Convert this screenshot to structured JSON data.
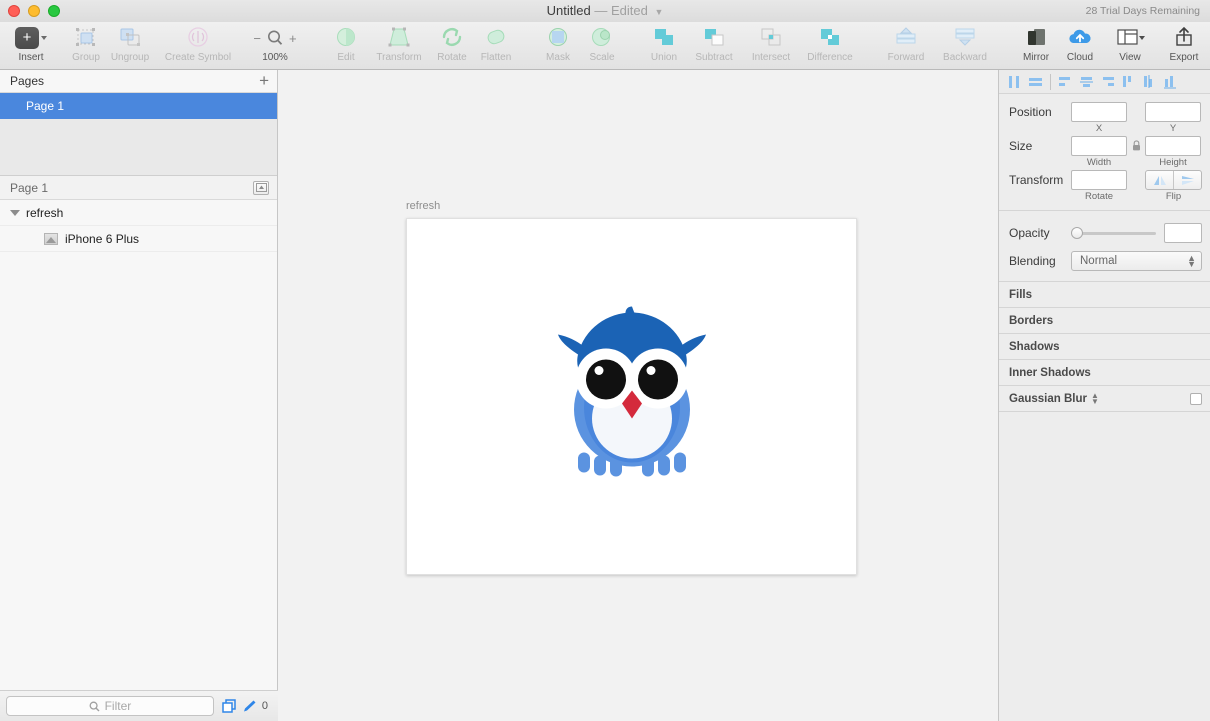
{
  "titlebar": {
    "document_name": "Untitled",
    "separator": "—",
    "edited_state": "Edited",
    "trial_notice": "28 Trial Days Remaining"
  },
  "toolbar": {
    "items": [
      {
        "label": "Insert",
        "icon": "plus-square-icon",
        "enabled": true
      },
      {
        "label": "Group",
        "icon": "group-icon",
        "enabled": false
      },
      {
        "label": "Ungroup",
        "icon": "ungroup-icon",
        "enabled": false
      },
      {
        "label": "Create Symbol",
        "icon": "create-symbol-icon",
        "enabled": false
      },
      {
        "label": "Edit",
        "icon": "edit-icon",
        "enabled": false
      },
      {
        "label": "Transform",
        "icon": "transform-icon",
        "enabled": false
      },
      {
        "label": "Rotate",
        "icon": "rotate-icon",
        "enabled": false
      },
      {
        "label": "Flatten",
        "icon": "flatten-icon",
        "enabled": false
      },
      {
        "label": "Mask",
        "icon": "mask-icon",
        "enabled": false
      },
      {
        "label": "Scale",
        "icon": "scale-icon",
        "enabled": false
      },
      {
        "label": "Union",
        "icon": "union-icon",
        "enabled": false
      },
      {
        "label": "Subtract",
        "icon": "subtract-icon",
        "enabled": false
      },
      {
        "label": "Intersect",
        "icon": "intersect-icon",
        "enabled": false
      },
      {
        "label": "Difference",
        "icon": "difference-icon",
        "enabled": false
      },
      {
        "label": "Forward",
        "icon": "move-forward-icon",
        "enabled": false
      },
      {
        "label": "Backward",
        "icon": "move-backward-icon",
        "enabled": false
      },
      {
        "label": "Mirror",
        "icon": "mirror-icon",
        "enabled": true
      },
      {
        "label": "Cloud",
        "icon": "cloud-upload-icon",
        "enabled": true
      },
      {
        "label": "View",
        "icon": "view-layout-icon",
        "enabled": true
      },
      {
        "label": "Export",
        "icon": "export-icon",
        "enabled": true
      }
    ],
    "zoom": {
      "minus": "−",
      "plus": "+",
      "level": "100%",
      "icon": "magnifier-icon"
    }
  },
  "sidebar": {
    "pages_header": "Pages",
    "add_page_label": "+",
    "pages": [
      {
        "name": "Page 1",
        "selected": true
      }
    ],
    "layers_header": "Page 1",
    "layers": [
      {
        "name": "refresh",
        "type": "artboard",
        "indent": 0,
        "expanded": true
      },
      {
        "name": "iPhone 6 Plus",
        "type": "image",
        "indent": 1
      }
    ],
    "filter": {
      "placeholder": "Filter",
      "value": "",
      "icon": "search-icon"
    },
    "filter_right": {
      "duplicate_icon": "copy-layers-icon",
      "pencil_icon": "pencil-icon",
      "count": "0"
    }
  },
  "canvas": {
    "artboard_name": "refresh",
    "background_color": "#f2f2f2",
    "artboard_fill": "#ffffff"
  },
  "artwork": {
    "name": "owl-illustration",
    "colors": {
      "head_dark_blue": "#1b63b5",
      "body_blue": "#4a86dc",
      "wing_light_blue": "#5b93e0",
      "face_white": "#ffffff",
      "belly_offwhite": "#f4f7fb",
      "eye_black": "#111111",
      "beak_red": "#d42a3c",
      "talon_blue": "#5b93e0"
    }
  },
  "inspector": {
    "align_buttons": [
      "align-left-icon",
      "align-center-horizontal-icon",
      "align-top-icon",
      "align-middle-icon",
      "align-bottom-icon",
      "distribute-left-icon",
      "distribute-center-icon",
      "distribute-right-icon"
    ],
    "position": {
      "label": "Position",
      "x_value": "",
      "x_sub": "X",
      "y_value": "",
      "y_sub": "Y"
    },
    "size": {
      "label": "Size",
      "width_value": "",
      "width_sub": "Width",
      "height_value": "",
      "height_sub": "Height",
      "lock_icon": "lock-icon"
    },
    "transform": {
      "label": "Transform",
      "rotate_value": "",
      "rotate_sub": "Rotate",
      "flip_sub": "Flip",
      "flip_h_icon": "flip-horizontal-icon",
      "flip_v_icon": "flip-vertical-icon"
    },
    "opacity": {
      "label": "Opacity",
      "value": ""
    },
    "blending": {
      "label": "Blending",
      "value": "Normal"
    },
    "sections": [
      {
        "label": "Fills",
        "has_checkbox": false,
        "has_stepper": false
      },
      {
        "label": "Borders",
        "has_checkbox": false,
        "has_stepper": false
      },
      {
        "label": "Shadows",
        "has_checkbox": false,
        "has_stepper": false
      },
      {
        "label": "Inner Shadows",
        "has_checkbox": false,
        "has_stepper": false
      },
      {
        "label": "Gaussian Blur",
        "has_checkbox": true,
        "has_stepper": true
      }
    ]
  }
}
